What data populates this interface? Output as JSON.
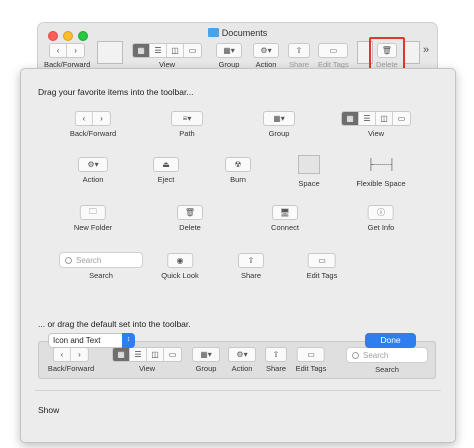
{
  "window": {
    "title": "Documents",
    "toolbar": {
      "back_forward": "Back/Forward",
      "view": "View",
      "group": "Group",
      "action": "Action",
      "share": "Share",
      "edit_tags": "Edit Tags",
      "delete": "Delete",
      "overflow": "»"
    }
  },
  "sheet": {
    "instruction": "Drag your favorite items into the toolbar...",
    "items": {
      "back_forward": "Back/Forward",
      "path": "Path",
      "group": "Group",
      "view": "View",
      "action": "Action",
      "eject": "Eject",
      "burn": "Burn",
      "space": "Space",
      "flexible_space": "Flexible Space",
      "new_folder": "New Folder",
      "delete": "Delete",
      "connect": "Connect",
      "get_info": "Get Info",
      "search": "Search",
      "search_placeholder": "Search",
      "quick_look": "Quick Look",
      "share": "Share",
      "edit_tags": "Edit Tags"
    },
    "default_instruction": "... or drag the default set into the toolbar.",
    "default_set": {
      "back_forward": "Back/Forward",
      "view": "View",
      "group": "Group",
      "action": "Action",
      "share": "Share",
      "edit_tags": "Edit Tags",
      "search": "Search",
      "search_placeholder": "Search"
    },
    "show_label": "Show",
    "show_value": "Icon and Text",
    "done_label": "Done"
  },
  "colors": {
    "accent": "#2e7ef0",
    "highlight": "#e0362c"
  }
}
